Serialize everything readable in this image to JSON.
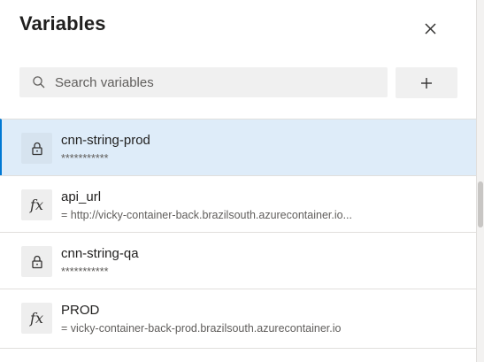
{
  "panel": {
    "title": "Variables"
  },
  "search": {
    "placeholder": "Search variables"
  },
  "toolbar": {
    "add_label": "+"
  },
  "variables": [
    {
      "name": "cnn-string-prod",
      "value": "***********",
      "icon": "lock-icon",
      "selected": true
    },
    {
      "name": "api_url",
      "value": "= http://vicky-container-back.brazilsouth.azurecontainer.io...",
      "icon": "function-fx-icon",
      "selected": false
    },
    {
      "name": "cnn-string-qa",
      "value": "***********",
      "icon": "lock-icon",
      "selected": false
    },
    {
      "name": "PROD",
      "value": "= vicky-container-back-prod.brazilsouth.azurecontainer.io",
      "icon": "function-fx-icon",
      "selected": false
    }
  ],
  "icons": {
    "fx_glyph": "fx"
  },
  "colors": {
    "accent": "#0078d4",
    "selected_bg": "#deecf9"
  }
}
